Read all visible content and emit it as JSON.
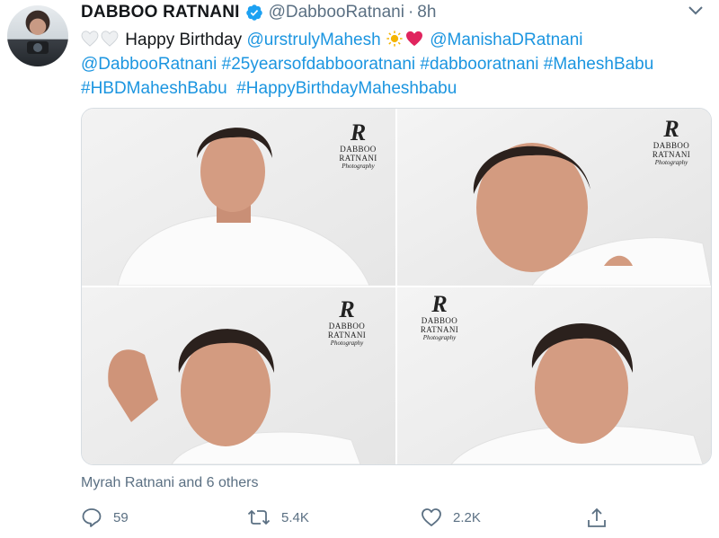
{
  "tweet": {
    "author_name": "DABBOO RATNANI",
    "handle": "@DabbooRatnani",
    "separator": "·",
    "time": "8h",
    "text": {
      "birthday_text": "Happy Birthday",
      "mention_mahesh": "@urstrulyMahesh",
      "mention_manisha": "@ManishaDRatnani",
      "mention_dabboo": "@DabbooRatnani",
      "tag_25years": "#25yearsofdabbooratnani",
      "tag_dabboo": "#dabbooratnani",
      "tag_mahesh": "#MaheshBabu",
      "tag_hbd": "#HBDMaheshBabu",
      "tag_happy": "#HappyBirthdayMaheshbabu"
    },
    "photo_logo": {
      "brand": "DABBOO RATNANI",
      "sub": "Photography"
    },
    "liked_by": "Myrah Ratnani and 6 others",
    "actions": {
      "reply_count": "59",
      "retweet_count": "5.4K",
      "like_count": "2.2K"
    }
  },
  "colors": {
    "link": "#1b95e0",
    "muted": "#5b7083",
    "verified": "#1da1f2"
  },
  "icons": [
    "verified-badge-icon",
    "chevron-down-icon",
    "white-heart-icon",
    "sun-icon",
    "red-heart-icon",
    "reply-icon",
    "retweet-icon",
    "like-icon",
    "share-icon"
  ]
}
